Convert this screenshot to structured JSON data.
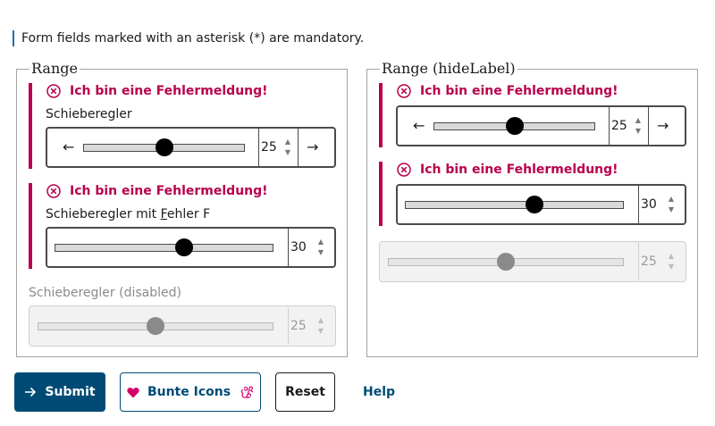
{
  "notice": "Form fields marked with an asterisk (*) are mandatory.",
  "left": {
    "legend": "Range",
    "error_message": "Ich bin eine Fehlermeldung!",
    "field1": {
      "label": "Schieberegler",
      "value": "25",
      "fraction": 0.49
    },
    "field2": {
      "label_prefix": "Schieberegler mit ",
      "label_underlined": "F",
      "label_suffix": "ehler F",
      "value": "30",
      "fraction": 0.59
    },
    "field3": {
      "label": "Schieberegler (disabled)",
      "value": "25",
      "fraction": 0.49
    }
  },
  "right": {
    "legend": "Range (hideLabel)",
    "error_message": "Ich bin eine Fehlermeldung!",
    "field1": {
      "value": "25",
      "fraction": 0.49
    },
    "field2": {
      "value": "30",
      "fraction": 0.59
    },
    "field3": {
      "value": "25",
      "fraction": 0.49
    }
  },
  "buttons": {
    "submit": "Submit",
    "bunte_icons": "Bunte Icons",
    "reset": "Reset",
    "help": "Help"
  },
  "colors": {
    "error": "#b8004d",
    "primary": "#004b76",
    "notice_bar": "#1e6fb0"
  },
  "icons": {
    "error": "circle-x-icon",
    "left_arrow": "arrow-left-icon",
    "right_arrow": "arrow-right-icon",
    "submit": "arrow-right-icon",
    "heart": "heart-icon",
    "squirrel": "squirrel-icon"
  }
}
